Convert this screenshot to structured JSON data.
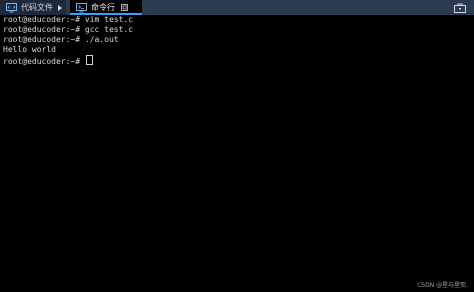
{
  "tabs": [
    {
      "label": "代码文件",
      "icon": "monitor-code-icon"
    },
    {
      "label": "命令行",
      "icon": "terminal-monitor-icon"
    }
  ],
  "toolbar": {
    "toolbox_icon": "toolbox-icon"
  },
  "terminal": {
    "lines": [
      "root@educoder:~# vim test.c",
      "root@educoder:~# gcc test.c",
      "root@educoder:~# ./a.out",
      "Hello world",
      "root@educoder:~# "
    ]
  },
  "watermark": "CSDN @星与星熙.",
  "colors": {
    "tabbar_bg": "#2c3a4f",
    "active_tab_accent": "#3aa0ff",
    "terminal_bg": "#000000",
    "terminal_text": "#d8d8d8"
  }
}
